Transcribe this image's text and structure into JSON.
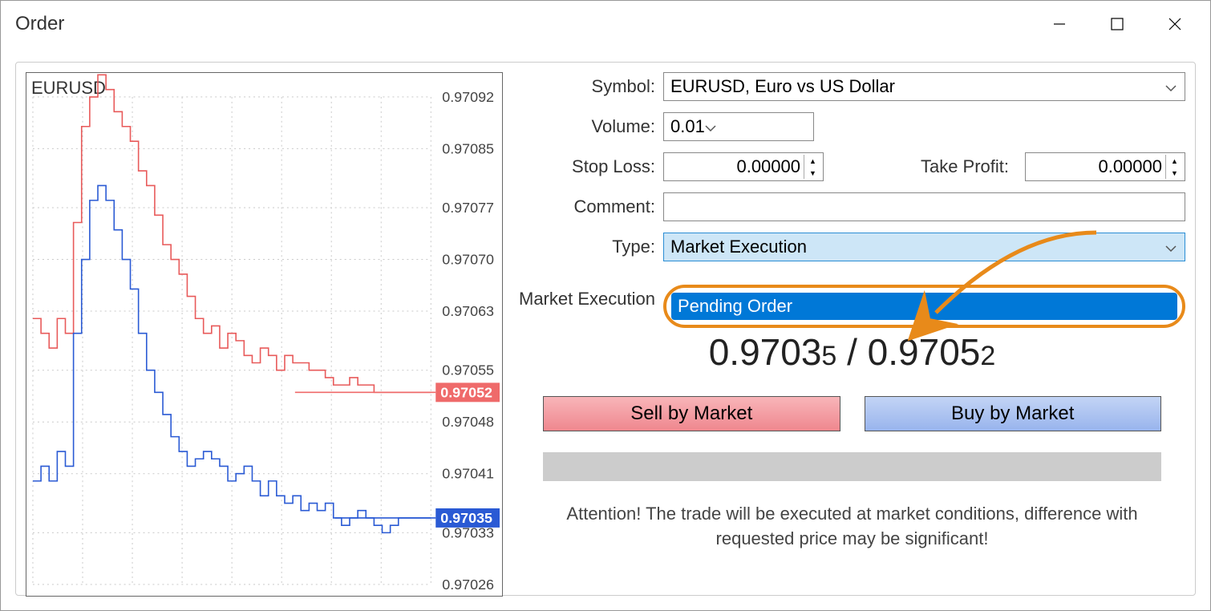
{
  "window": {
    "title": "Order"
  },
  "form": {
    "symbol_label": "Symbol:",
    "symbol_value": "EURUSD, Euro vs US Dollar",
    "volume_label": "Volume:",
    "volume_value": "0.01",
    "stoploss_label": "Stop Loss:",
    "stoploss_value": "0.00000",
    "takeprofit_label": "Take Profit:",
    "takeprofit_value": "0.00000",
    "comment_label": "Comment:",
    "comment_value": "",
    "type_label": "Type:",
    "type_value": "Market Execution",
    "dropdown_option": "Pending Order",
    "group_label": "Market Execution",
    "quote_bid_main": "0.9703",
    "quote_bid_sub": "5",
    "quote_sep": " / ",
    "quote_ask_main": "0.9705",
    "quote_ask_sub": "2",
    "sell_btn": "Sell by Market",
    "buy_btn": "Buy by Market",
    "attention": "Attention! The trade will be executed at market conditions, difference with requested price may be significant!"
  },
  "chart": {
    "symbol": "EURUSD",
    "bid_tag": "0.97035",
    "ask_tag": "0.97052"
  },
  "chart_data": {
    "type": "line",
    "title": "EURUSD",
    "xlabel": "",
    "ylabel": "",
    "ylim": [
      0.97026,
      0.97092
    ],
    "y_ticks": [
      0.97092,
      0.97085,
      0.97077,
      0.9707,
      0.97063,
      0.97055,
      0.97048,
      0.97041,
      0.97033,
      0.97026
    ],
    "price_tags": {
      "ask": 0.97052,
      "bid": 0.97035
    },
    "series": [
      {
        "name": "ask",
        "color": "#e85a5a",
        "values": [
          0.97062,
          0.9706,
          0.97058,
          0.97062,
          0.9706,
          0.97075,
          0.97088,
          0.97092,
          0.97095,
          0.97093,
          0.9709,
          0.97088,
          0.97086,
          0.97082,
          0.9708,
          0.97076,
          0.97072,
          0.9707,
          0.97068,
          0.97065,
          0.97062,
          0.9706,
          0.97061,
          0.97058,
          0.9706,
          0.97059,
          0.97057,
          0.97056,
          0.97058,
          0.97057,
          0.97055,
          0.97057,
          0.97056,
          0.97056,
          0.97055,
          0.97055,
          0.97054,
          0.97053,
          0.97053,
          0.97054,
          0.97053,
          0.97053,
          0.97052,
          0.97052,
          0.97052,
          0.97052,
          0.97052,
          0.97052,
          0.97052,
          0.97052
        ]
      },
      {
        "name": "bid",
        "color": "#2a5ad4",
        "values": [
          0.9704,
          0.97042,
          0.9704,
          0.97044,
          0.97042,
          0.9706,
          0.9707,
          0.97078,
          0.9708,
          0.97078,
          0.97074,
          0.9707,
          0.97066,
          0.9706,
          0.97055,
          0.97052,
          0.97049,
          0.97046,
          0.97044,
          0.97042,
          0.97043,
          0.97044,
          0.97043,
          0.97042,
          0.9704,
          0.97041,
          0.97042,
          0.9704,
          0.97038,
          0.9704,
          0.97038,
          0.97037,
          0.97038,
          0.97036,
          0.97037,
          0.97036,
          0.97037,
          0.97035,
          0.97034,
          0.97035,
          0.97036,
          0.97035,
          0.97034,
          0.97033,
          0.97034,
          0.97035,
          0.97035,
          0.97035,
          0.97035,
          0.97035
        ]
      }
    ]
  }
}
